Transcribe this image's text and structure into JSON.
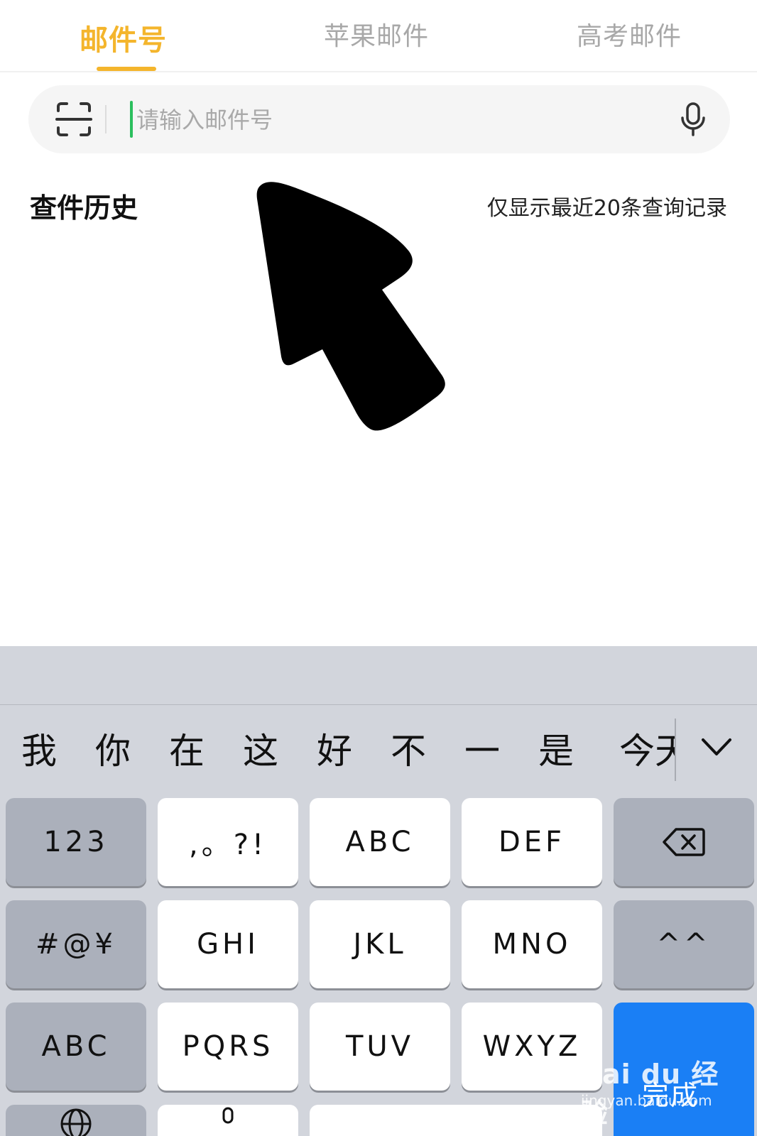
{
  "tabs": [
    {
      "label": "邮件号",
      "active": true
    },
    {
      "label": "苹果邮件",
      "active": false
    },
    {
      "label": "高考邮件",
      "active": false
    }
  ],
  "colors": {
    "accent": "#f4b52c",
    "caret": "#2bbf5e",
    "done_key": "#1a7ff5",
    "keyboard_bg": "#d2d5dc"
  },
  "search": {
    "placeholder": "请输入邮件号",
    "value": "",
    "left_icon": "scan-icon",
    "right_icon": "microphone-icon"
  },
  "history": {
    "title": "查件历史",
    "note": "仅显示最近20条查询记录"
  },
  "keyboard": {
    "candidates": [
      "我",
      "你",
      "在",
      "这",
      "好",
      "不",
      "一",
      "是"
    ],
    "candidate_partial": "今天",
    "rows": [
      [
        "123",
        ",。?!",
        "ABC",
        "DEF"
      ],
      [
        "#@¥",
        "GHI",
        "JKL",
        "MNO",
        "^^"
      ],
      [
        "ABC",
        "PQRS",
        "TUV",
        "WXYZ"
      ]
    ],
    "done": "完成"
  },
  "watermark": {
    "main": "Bai du 经验",
    "sub": "jingyan.baidu.com"
  }
}
